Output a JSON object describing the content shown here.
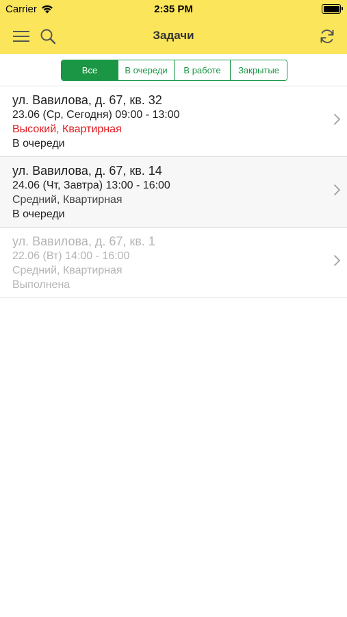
{
  "status": {
    "carrier": "Carrier",
    "time": "2:35 PM"
  },
  "header": {
    "title": "Задачи"
  },
  "tabs": [
    {
      "label": "Все"
    },
    {
      "label": "В очереди"
    },
    {
      "label": "В работе"
    },
    {
      "label": "Закрытые"
    }
  ],
  "tasks": [
    {
      "address": "ул. Вавилова, д. 67, кв. 32",
      "schedule": "23.06 (Ср, Сегодня)  09:00 - 13:00",
      "priority": "Высокий, Квартирная",
      "state": "В очереди"
    },
    {
      "address": "ул. Вавилова, д. 67, кв. 14",
      "schedule": "24.06 (Чт, Завтра)  13:00 - 16:00",
      "priority": "Средний, Квартирная",
      "state": "В очереди"
    },
    {
      "address": "ул. Вавилова, д. 67, кв. 1",
      "schedule": "22.06 (Вт)  14:00 - 16:00",
      "priority": "Средний, Квартирная",
      "state": "Выполнена"
    }
  ],
  "colors": {
    "header_bg": "#fbe55b",
    "accent": "#1a9645",
    "priority_high": "#e0191e",
    "done_text": "#b5b5b5"
  },
  "icons": {
    "menu": "hamburger-icon",
    "search": "search-icon",
    "refresh": "refresh-icon",
    "chevron": "chevron-right-icon"
  }
}
